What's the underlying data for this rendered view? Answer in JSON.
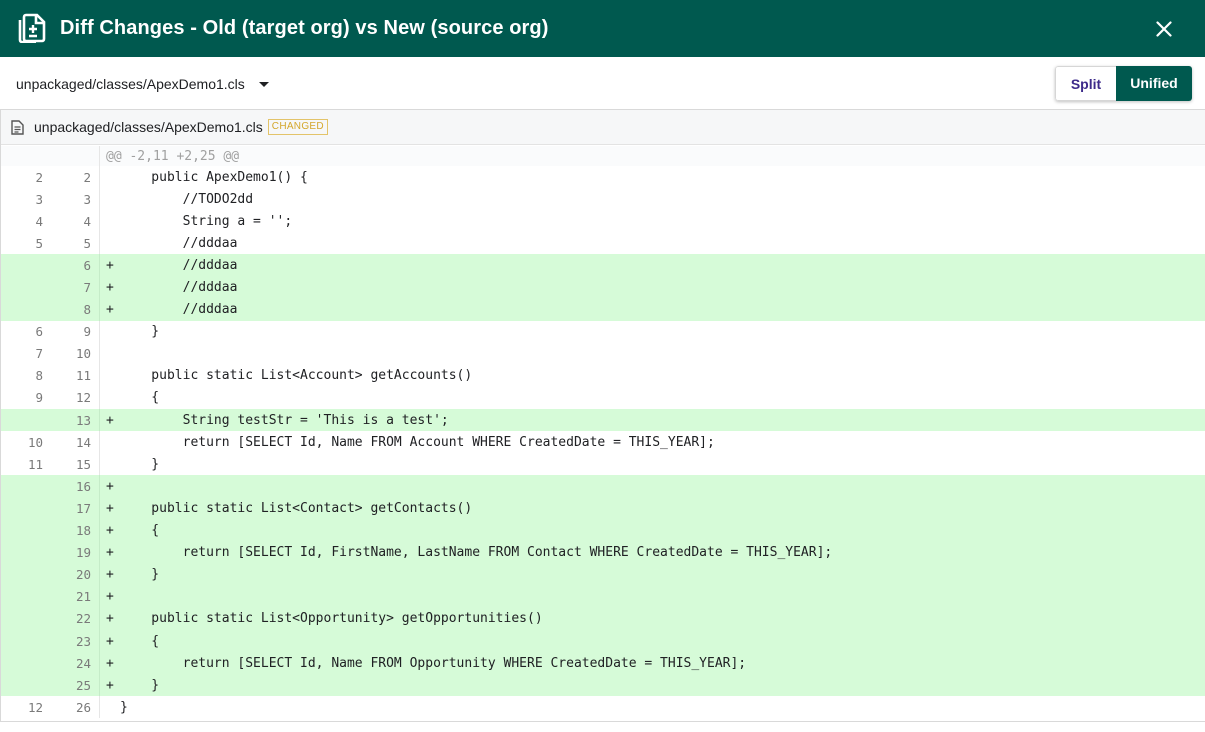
{
  "dialog": {
    "title": "Diff Changes - Old (target org) vs New (source org)",
    "close_icon": "close-icon",
    "title_icon": "document-diff-icon"
  },
  "toolbar": {
    "file_selected": "unpackaged/classes/ApexDemo1.cls",
    "view_split": "Split",
    "view_unified": "Unified",
    "active_view": "Unified"
  },
  "file": {
    "name": "unpackaged/classes/ApexDemo1.cls",
    "status": "CHANGED"
  },
  "hunk_header": "@@ -2,11 +2,25 @@",
  "lines": [
    {
      "old": "2",
      "new": "2",
      "sign": "",
      "type": "context",
      "code": "    public ApexDemo1() {"
    },
    {
      "old": "3",
      "new": "3",
      "sign": "",
      "type": "context",
      "code": "        //TODO2dd"
    },
    {
      "old": "4",
      "new": "4",
      "sign": "",
      "type": "context",
      "code": "        String a = '';"
    },
    {
      "old": "5",
      "new": "5",
      "sign": "",
      "type": "context",
      "code": "        //dddaa"
    },
    {
      "old": "",
      "new": "6",
      "sign": "+",
      "type": "add",
      "code": "        //dddaa"
    },
    {
      "old": "",
      "new": "7",
      "sign": "+",
      "type": "add",
      "code": "        //dddaa"
    },
    {
      "old": "",
      "new": "8",
      "sign": "+",
      "type": "add",
      "code": "        //dddaa"
    },
    {
      "old": "6",
      "new": "9",
      "sign": "",
      "type": "context",
      "code": "    }"
    },
    {
      "old": "7",
      "new": "10",
      "sign": "",
      "type": "context",
      "code": ""
    },
    {
      "old": "8",
      "new": "11",
      "sign": "",
      "type": "context",
      "code": "    public static List<Account> getAccounts()"
    },
    {
      "old": "9",
      "new": "12",
      "sign": "",
      "type": "context",
      "code": "    {"
    },
    {
      "old": "",
      "new": "13",
      "sign": "+",
      "type": "add",
      "code": "        String testStr = 'This is a test';"
    },
    {
      "old": "10",
      "new": "14",
      "sign": "",
      "type": "context",
      "code": "        return [SELECT Id, Name FROM Account WHERE CreatedDate = THIS_YEAR];"
    },
    {
      "old": "11",
      "new": "15",
      "sign": "",
      "type": "context",
      "code": "    }"
    },
    {
      "old": "",
      "new": "16",
      "sign": "+",
      "type": "add",
      "code": ""
    },
    {
      "old": "",
      "new": "17",
      "sign": "+",
      "type": "add",
      "code": "    public static List<Contact> getContacts()"
    },
    {
      "old": "",
      "new": "18",
      "sign": "+",
      "type": "add",
      "code": "    {"
    },
    {
      "old": "",
      "new": "19",
      "sign": "+",
      "type": "add",
      "code": "        return [SELECT Id, FirstName, LastName FROM Contact WHERE CreatedDate = THIS_YEAR];"
    },
    {
      "old": "",
      "new": "20",
      "sign": "+",
      "type": "add",
      "code": "    }"
    },
    {
      "old": "",
      "new": "21",
      "sign": "+",
      "type": "add",
      "code": ""
    },
    {
      "old": "",
      "new": "22",
      "sign": "+",
      "type": "add",
      "code": "    public static List<Opportunity> getOpportunities()"
    },
    {
      "old": "",
      "new": "23",
      "sign": "+",
      "type": "add",
      "code": "    {"
    },
    {
      "old": "",
      "new": "24",
      "sign": "+",
      "type": "add",
      "code": "        return [SELECT Id, Name FROM Opportunity WHERE CreatedDate = THIS_YEAR];"
    },
    {
      "old": "",
      "new": "25",
      "sign": "+",
      "type": "add",
      "code": "    }"
    },
    {
      "old": "12",
      "new": "26",
      "sign": "",
      "type": "context",
      "code": "}"
    }
  ],
  "colors": {
    "header_bg": "#00594f",
    "added_line_bg": "#d6fbd8",
    "badge": "#d4a72c"
  }
}
